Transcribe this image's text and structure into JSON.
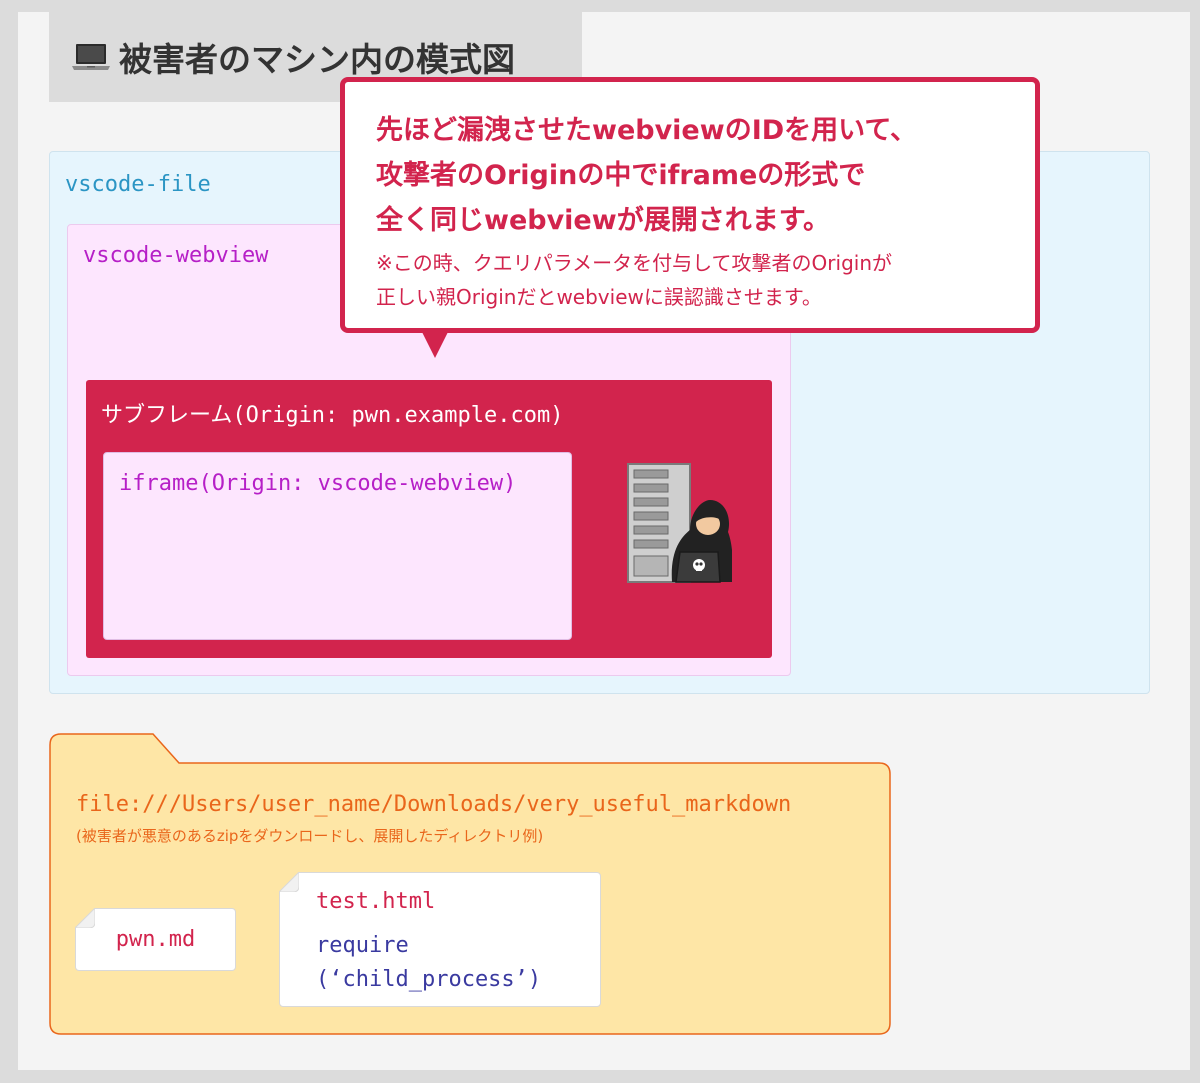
{
  "title": "被害者のマシン内の模式図",
  "boxes": {
    "vscode_file": "vscode-file",
    "vscode_webview": "vscode-webview",
    "subframe": "サブフレーム(Origin: pwn.example.com)",
    "iframe": "iframe(Origin: vscode-webview)"
  },
  "callout": {
    "main_lines": [
      "先ほど漏洩させたwebviewのIDを用いて、",
      "攻撃者のOriginの中でiframeの形式で",
      "全く同じwebviewが展開されます。"
    ],
    "note_lines": [
      "※この時、クエリパラメータを付与して攻撃者のOriginが",
      "正しい親Originだとwebviewに誤認識させます。"
    ]
  },
  "folder": {
    "path": "file:///Users/user_name/Downloads/very_useful_markdown",
    "note": "(被害者が悪意のあるzipをダウンロードし、展開したディレクトリ例)"
  },
  "files": {
    "pwn": {
      "name": "pwn.md"
    },
    "test": {
      "name": "test.html",
      "code_lines": [
        "require",
        "(‘child_process’)"
      ]
    }
  },
  "colors": {
    "accent_red": "#d2244d",
    "file_blue": "#e6f5fd",
    "webview_pink": "#fde6fe",
    "folder_yellow": "#fee6a6",
    "folder_orange": "#e9661b"
  }
}
